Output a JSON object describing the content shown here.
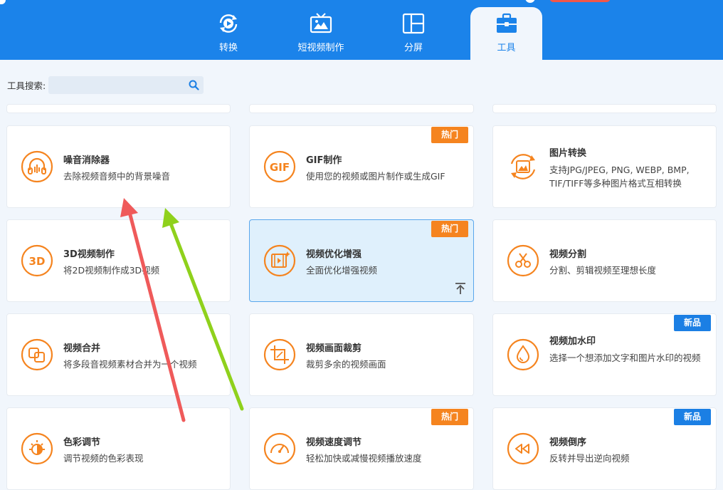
{
  "colors": {
    "brand": "#1b83ea",
    "accent": "#f5841f",
    "hot": "#f5841f",
    "new": "#1b7fe4",
    "arrow_red": "#ef5a5a",
    "arrow_green": "#8fd11c"
  },
  "tabs": [
    {
      "label": "转换",
      "icon": "convert-icon"
    },
    {
      "label": "短视频制作",
      "icon": "tv-icon"
    },
    {
      "label": "分屏",
      "icon": "split-screen-icon"
    },
    {
      "label": "工具",
      "icon": "toolbox-icon",
      "active": true
    }
  ],
  "search": {
    "label": "工具搜索:",
    "value": "",
    "placeholder": ""
  },
  "tools": [
    {
      "title": "噪音消除器",
      "desc": "去除视频音频中的背景噪音",
      "icon": "noise-reduction-icon"
    },
    {
      "title": "GIF制作",
      "desc": "使用您的视频或图片制作或生成GIF",
      "icon": "gif-icon",
      "badge": "热门"
    },
    {
      "title": "图片转换",
      "desc": "支持JPG/JPEG, PNG, WEBP, BMP, TIF/TIFF等多种图片格式互相转换",
      "icon": "image-convert-icon"
    },
    {
      "title": "3D视频制作",
      "desc": "将2D视频制作成3D视频",
      "icon": "3d-icon"
    },
    {
      "title": "视频优化增强",
      "desc": "全面优化增强视频",
      "icon": "video-enhance-icon",
      "badge": "热门",
      "selected": true
    },
    {
      "title": "视频分割",
      "desc": "分割、剪辑视频至理想长度",
      "icon": "scissors-icon"
    },
    {
      "title": "视频合并",
      "desc": "将多段音视频素材合并为一个视频",
      "icon": "merge-icon"
    },
    {
      "title": "视频画面裁剪",
      "desc": "裁剪多余的视频画面",
      "icon": "crop-icon"
    },
    {
      "title": "视频加水印",
      "desc": "选择一个想添加文字和图片水印的视频",
      "icon": "watermark-icon",
      "badge": "新品"
    },
    {
      "title": "色彩调节",
      "desc": "调节视频的色彩表现",
      "icon": "color-adjust-icon"
    },
    {
      "title": "视频速度调节",
      "desc": "轻松加快或减慢视频播放速度",
      "icon": "speed-icon",
      "badge": "热门"
    },
    {
      "title": "视频倒序",
      "desc": "反转并导出逆向视频",
      "icon": "reverse-icon",
      "badge": "新品"
    }
  ]
}
